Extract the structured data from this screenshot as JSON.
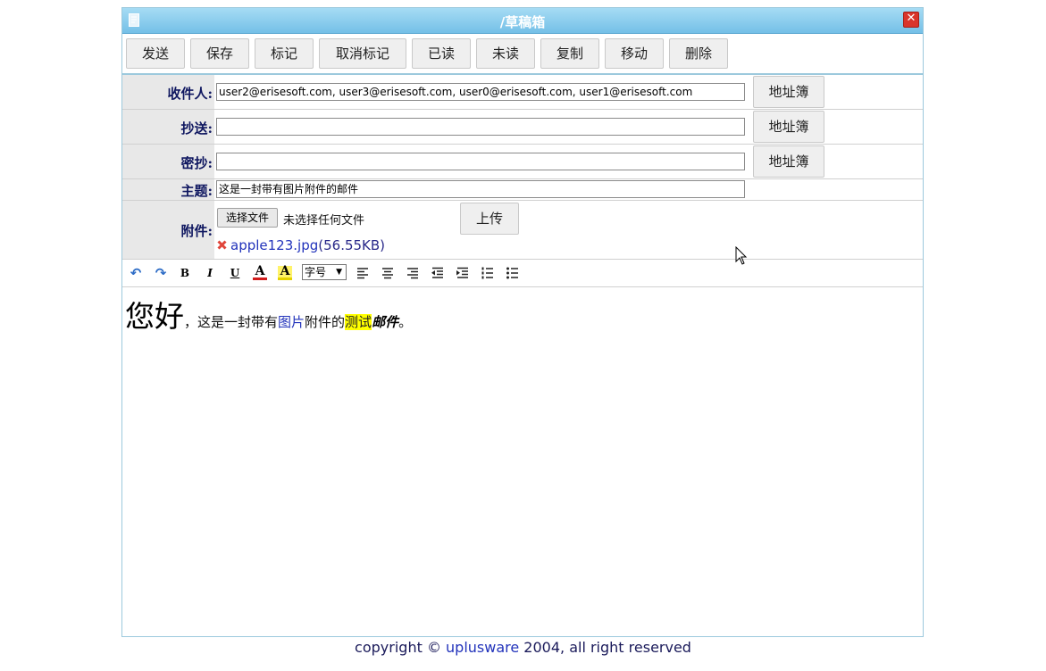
{
  "window": {
    "title": "/草稿箱",
    "icon": "draft-doc-icon",
    "close_icon": "close-icon",
    "close_glyph": "✕"
  },
  "toolbar": {
    "buttons": [
      "发送",
      "保存",
      "标记",
      "取消标记",
      "已读",
      "未读",
      "复制",
      "移动",
      "删除"
    ]
  },
  "form": {
    "to": {
      "label": "收件人:",
      "value": "user2@erisesoft.com, user3@erisesoft.com, user0@erisesoft.com, user1@erisesoft.com",
      "addr_button": "地址簿"
    },
    "cc": {
      "label": "抄送:",
      "value": "",
      "addr_button": "地址簿"
    },
    "bcc": {
      "label": "密抄:",
      "value": "",
      "addr_button": "地址簿"
    },
    "subject": {
      "label": "主题:",
      "value": "这是一封带有图片附件的邮件"
    },
    "attachment": {
      "label": "附件:",
      "choose_button": "选择文件",
      "no_file_text": "未选择任何文件",
      "upload_button": "上传",
      "file_name": "apple123.jpg",
      "file_size": "(56.55KB)"
    }
  },
  "format_toolbar": {
    "undo": "↶",
    "redo": "↷",
    "bold": "B",
    "italic": "I",
    "underline": "U",
    "font_color": "A",
    "highlight": "A",
    "font_size_label": "字号",
    "icons": [
      "undo-icon",
      "redo-icon",
      "bold-icon",
      "italic-icon",
      "underline-icon",
      "font-color-icon",
      "highlight-color-icon",
      "align-left-icon",
      "align-center-icon",
      "align-right-icon",
      "outdent-icon",
      "indent-icon",
      "ordered-list-icon",
      "unordered-list-icon"
    ]
  },
  "editor": {
    "greeting": "您好",
    "text1": "，这是一封带有",
    "link_text": "图片",
    "text2": "附件的",
    "highlight_text": "测试",
    "bold_italic_text": "邮件",
    "period": "。"
  },
  "footer": {
    "prefix": "copyright © ",
    "brand": "uplusware",
    "suffix": " 2004, all right reserved"
  }
}
